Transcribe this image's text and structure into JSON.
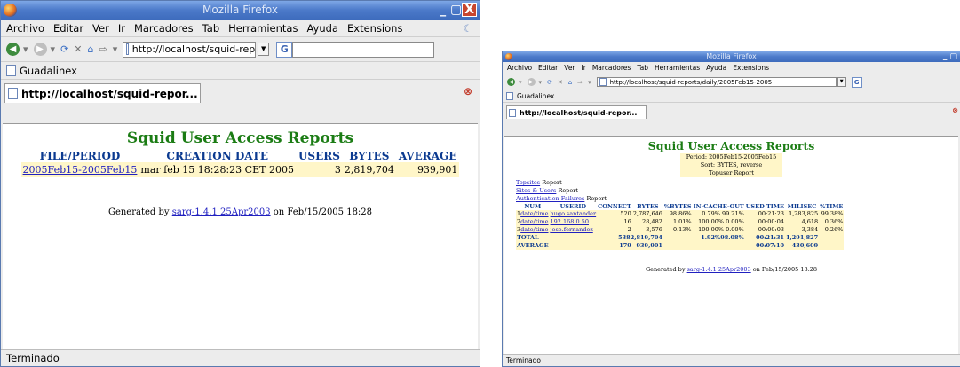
{
  "app": {
    "title": "Mozilla Firefox",
    "menu": [
      "Archivo",
      "Editar",
      "Ver",
      "Ir",
      "Marcadores",
      "Tab",
      "Herramientas",
      "Ayuda",
      "Extensions"
    ],
    "bookmark": "Guadalinex",
    "search_button": "G",
    "status": "Terminado",
    "title_controls": "_ ▢",
    "close_glyph": "X",
    "tab_close": "⊗"
  },
  "win1": {
    "url": "http://localhost/squid-rep",
    "tab_title": "http://localhost/squid-repor...",
    "report": {
      "title": "Squid User Access Reports",
      "headers": [
        "FILE/PERIOD",
        "CREATION DATE",
        "USERS",
        "BYTES",
        "AVERAGE"
      ],
      "row": {
        "period": "2005Feb15-2005Feb15",
        "date": "mar feb 15 18:28:23 CET 2005",
        "users": "3",
        "bytes": "2,819,704",
        "average": "939,901"
      }
    },
    "footer": {
      "prefix": "Generated by",
      "link": "sarg-1.4.1 25Apr2003",
      "suffix": "on Feb/15/2005 18:28"
    }
  },
  "win2": {
    "url": "http://localhost/squid-reports/daily/2005Feb15-2005",
    "tab_title": "http://localhost/squid-repor...",
    "report": {
      "title": "Squid User Access Reports",
      "period": "Period: 2005Feb15-2005Feb15",
      "sort": "Sort: BYTES, reverse",
      "subtitle": "Topuser Report",
      "links": [
        {
          "link": "Topsites",
          "text": "Report"
        },
        {
          "link": "Sites & Users",
          "text": "Report"
        },
        {
          "link": "Authentication Failures",
          "text": "Report"
        }
      ],
      "headers": [
        "NUM",
        "USERID",
        "CONNECT",
        "BYTES",
        "%BYTES",
        "IN-CACHE-OUT",
        "USED TIME",
        "MILISEC",
        "%TIME"
      ],
      "link_label": "date/time",
      "rows": [
        {
          "num": "1",
          "userid": "hugo.santander",
          "connect": "520",
          "bytes": "2,787,646",
          "pbytes": "98.86%",
          "incache": "0.79% 99.21%",
          "used": "00:21:23",
          "milisec": "1,283,825",
          "ptime": "99.38%"
        },
        {
          "num": "2",
          "userid": "192.168.0.50",
          "connect": "16",
          "bytes": "28,482",
          "pbytes": "1.01%",
          "incache": "100.00% 0.00%",
          "used": "00:00:04",
          "milisec": "4,618",
          "ptime": "0.36%"
        },
        {
          "num": "3",
          "userid": "jose.fernandez",
          "connect": "2",
          "bytes": "3,576",
          "pbytes": "0.13%",
          "incache": "100.00% 0.00%",
          "used": "00:00:03",
          "milisec": "3,384",
          "ptime": "0.26%"
        }
      ],
      "total": {
        "label": "TOTAL",
        "connect_bytes": "5382,819,704",
        "incache": "1.92%98.08%",
        "used": "00:21:31",
        "milisec": "1,291,827"
      },
      "average": {
        "label": "AVERAGE",
        "connect": "179",
        "bytes": "939,901",
        "used": "00:07:10",
        "milisec": "430,609"
      }
    },
    "footer": {
      "prefix": "Generated by",
      "link": "sarg-1.4.1 25Apr2003",
      "suffix": "on Feb/15/2005 18:28"
    }
  }
}
